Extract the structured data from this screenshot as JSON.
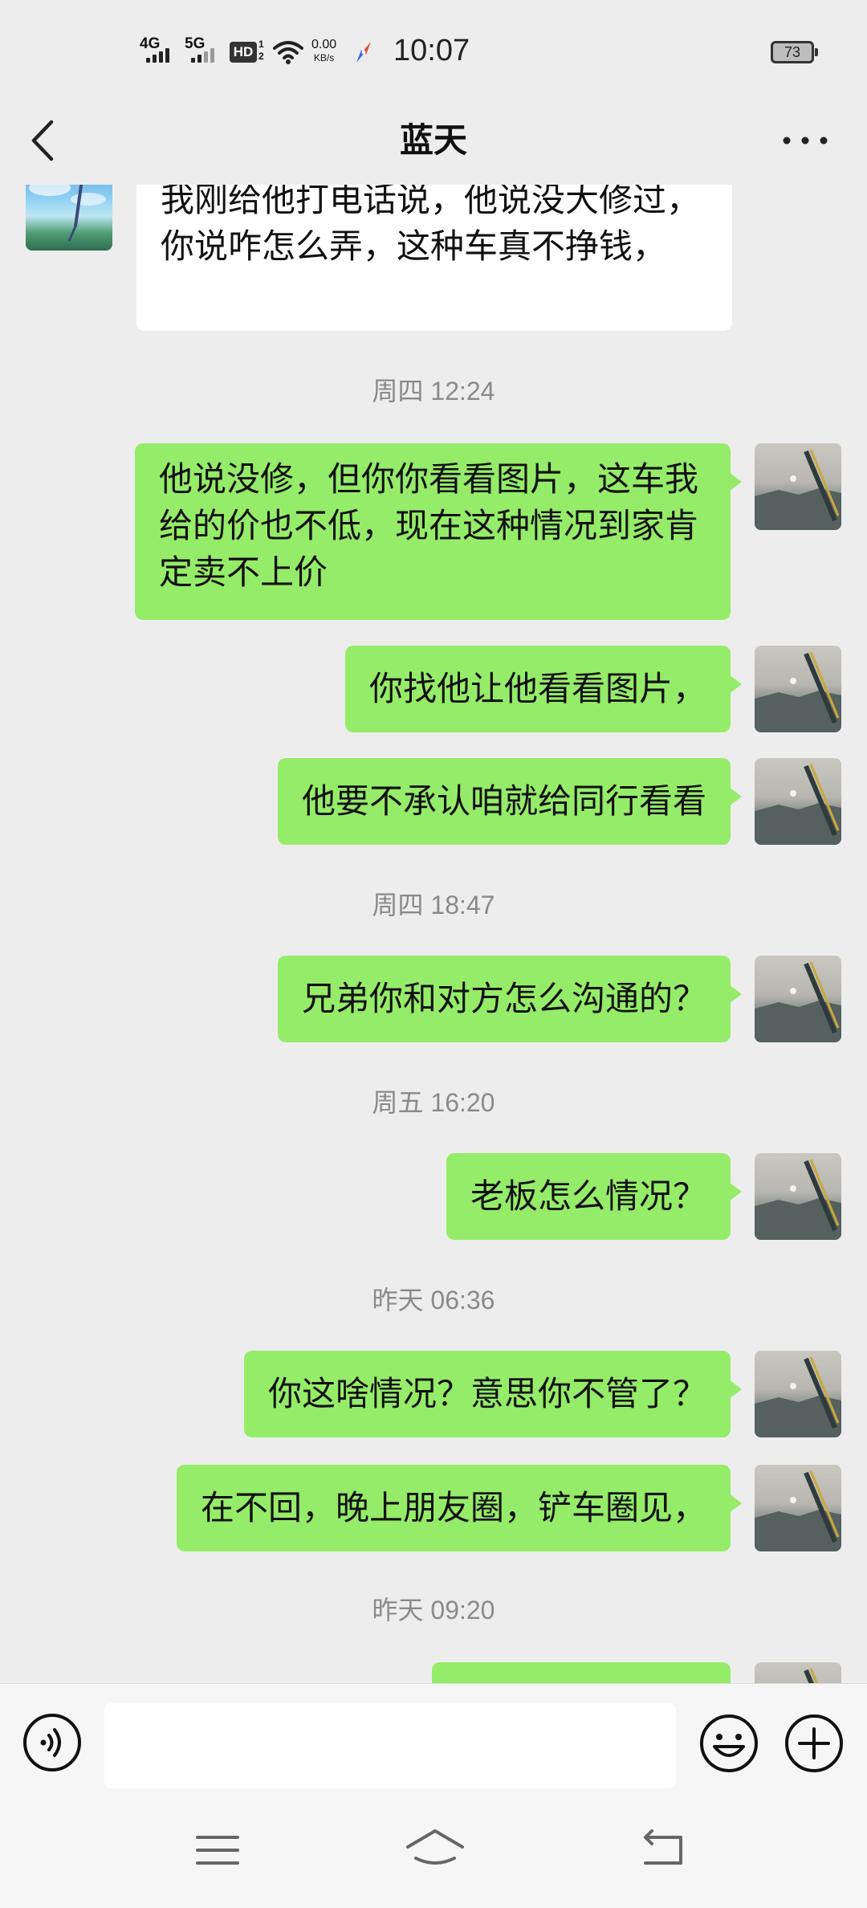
{
  "status_bar": {
    "net1": "4G",
    "net2": "5G",
    "hd_label": "HD",
    "hd_sub_top": "1",
    "hd_sub_bottom": "2",
    "speed_value": "0.00",
    "speed_unit": "KB/s",
    "time": "10:07",
    "battery": "73"
  },
  "header": {
    "title": "蓝天"
  },
  "messages": [
    {
      "type": "in",
      "text": "我刚给他打电话说，他说没大修过，你说咋怎么弄，这种车真不挣钱，"
    },
    {
      "type": "time",
      "text": "周四 12:24"
    },
    {
      "type": "out",
      "text": "他说没修，但你你看看图片，这车我给的价也不低，现在这种情况到家肯定卖不上价"
    },
    {
      "type": "out",
      "text": "你找他让他看看图片，"
    },
    {
      "type": "out",
      "text": "他要不承认咱就给同行看看"
    },
    {
      "type": "time",
      "text": "周四 18:47"
    },
    {
      "type": "out",
      "text": "兄弟你和对方怎么沟通的？"
    },
    {
      "type": "time",
      "text": "周五 16:20"
    },
    {
      "type": "out",
      "text": "老板怎么情况？"
    },
    {
      "type": "time",
      "text": "昨天 06:36"
    },
    {
      "type": "out",
      "text": "你这啥情况？意思你不管了？"
    },
    {
      "type": "out",
      "text": "在不回，晚上朋友圈，铲车圈见，"
    },
    {
      "type": "time",
      "text": "昨天 09:20"
    },
    {
      "type": "out",
      "text": ""
    }
  ],
  "input": {
    "value": "",
    "placeholder": ""
  },
  "icons": {
    "back": "chevron-left-icon",
    "more": "more-dots-icon",
    "voice": "voice-icon",
    "emoji": "emoji-icon",
    "plus": "plus-icon",
    "nav_menu": "menu-icon",
    "nav_home": "home-icon",
    "nav_back": "back-icon"
  },
  "colors": {
    "background": "#ededed",
    "out_bubble": "#95ec69",
    "in_bubble": "#ffffff",
    "timestamp": "#8a8a8a"
  }
}
